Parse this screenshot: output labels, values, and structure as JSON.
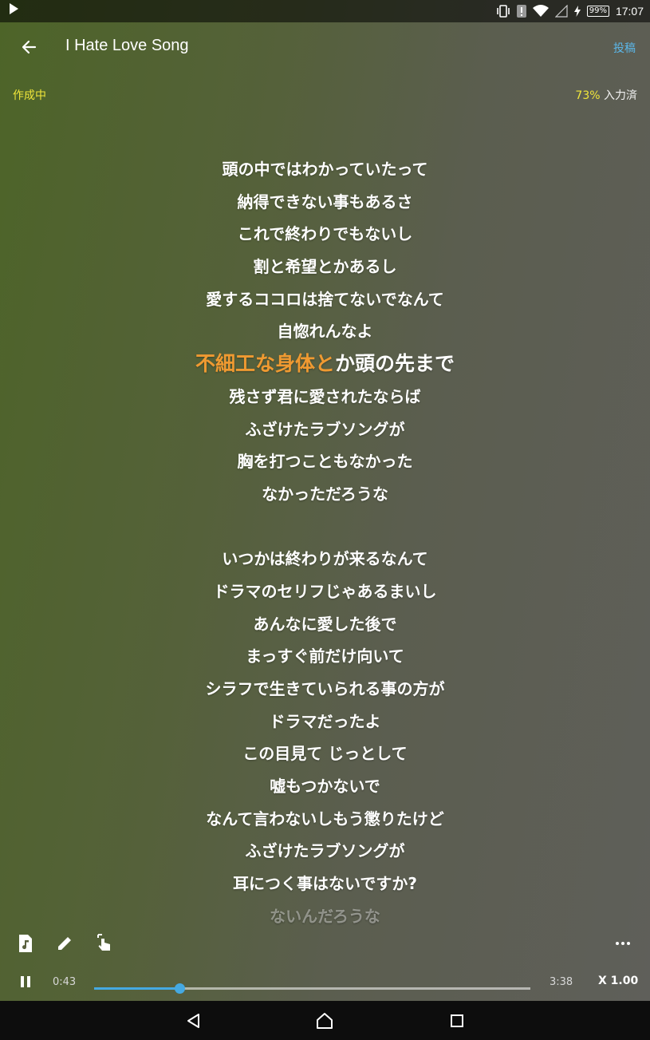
{
  "status_bar": {
    "time": "17:07",
    "battery": "99%"
  },
  "app_bar": {
    "title": "I Hate Love Song",
    "post_label": "投稿"
  },
  "status_row": {
    "state": "作成中",
    "percent": "73%",
    "input_label": "入力済"
  },
  "lyrics": {
    "lines": [
      "頭の中ではわかっていたって",
      "納得できない事もあるさ",
      "これで終わりでもないし",
      "割と希望とかあるし",
      "愛するココロは捨てないでなんて",
      "自惚れんなよ"
    ],
    "current_done": "不細工な身体と",
    "current_rest": "か頭の先まで",
    "lines_after": [
      "残さず君に愛されたならば",
      "ふざけたラブソングが",
      "胸を打つこともなかった",
      "なかっただろうな",
      "",
      "いつかは終わりが来るなんて",
      "ドラマのセリフじゃあるまいし",
      "あんなに愛した後で",
      "まっすぐ前だけ向いて",
      "シラフで生きていられる事の方が",
      "ドラマだったよ",
      "この目見て じっとして",
      "嘘もつかないで",
      "なんて言わないしもう懲りたけど",
      "ふざけたラブソングが",
      "耳につく事はないですか?"
    ],
    "faded_line": "ないんだろうな"
  },
  "toolbar": {
    "icons": [
      "music-file-icon",
      "pencil-icon",
      "touch-icon",
      "more-icon"
    ]
  },
  "playback": {
    "current_time": "0:43",
    "total_time": "3:38",
    "speed": "X 1.00",
    "progress": 0.196
  },
  "colors": {
    "accent": "#45a9e2",
    "highlight": "#f09a31",
    "yellow": "#f0e63a",
    "post": "#5bb6e8"
  }
}
